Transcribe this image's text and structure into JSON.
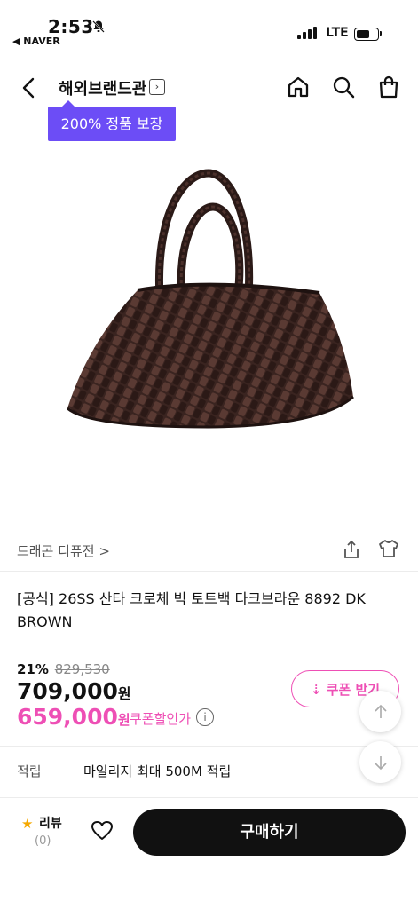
{
  "status_bar": {
    "time": "2:53",
    "back_app": "◀ NAVER",
    "network": "LTE"
  },
  "header": {
    "brand_title": "해외브랜드관",
    "badge": "200% 정품 보장"
  },
  "product": {
    "brand_link": "드래곤 디퓨전 >",
    "title": "[공식] 26SS 산타 크로체 빅 토트백 다크브라운 8892 DK BROWN",
    "discount_percent": "21%",
    "original_price": "829,530",
    "price": "709,000",
    "price_unit": "원",
    "coupon_price": "659,000",
    "coupon_price_unit": "원",
    "coupon_how": "쿠폰할인가",
    "coupon_button": "⇣ 쿠폰 받기"
  },
  "points": {
    "label": "적립",
    "value": "마일리지 최대 500M 적립"
  },
  "bottom_bar": {
    "review_label": "리뷰",
    "review_count": "(0)",
    "buy_label": "구매하기"
  },
  "colors": {
    "accent_purple": "#6c4df6",
    "accent_pink": "#ee4fb5",
    "buy_button": "#111111"
  }
}
